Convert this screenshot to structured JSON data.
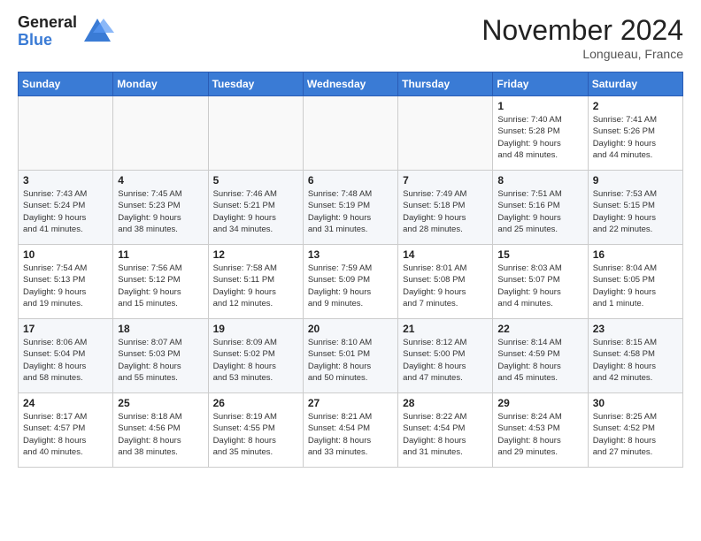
{
  "header": {
    "logo_general": "General",
    "logo_blue": "Blue",
    "month_title": "November 2024",
    "location": "Longueau, France"
  },
  "weekdays": [
    "Sunday",
    "Monday",
    "Tuesday",
    "Wednesday",
    "Thursday",
    "Friday",
    "Saturday"
  ],
  "weeks": [
    [
      {
        "day": "",
        "info": ""
      },
      {
        "day": "",
        "info": ""
      },
      {
        "day": "",
        "info": ""
      },
      {
        "day": "",
        "info": ""
      },
      {
        "day": "",
        "info": ""
      },
      {
        "day": "1",
        "info": "Sunrise: 7:40 AM\nSunset: 5:28 PM\nDaylight: 9 hours\nand 48 minutes."
      },
      {
        "day": "2",
        "info": "Sunrise: 7:41 AM\nSunset: 5:26 PM\nDaylight: 9 hours\nand 44 minutes."
      }
    ],
    [
      {
        "day": "3",
        "info": "Sunrise: 7:43 AM\nSunset: 5:24 PM\nDaylight: 9 hours\nand 41 minutes."
      },
      {
        "day": "4",
        "info": "Sunrise: 7:45 AM\nSunset: 5:23 PM\nDaylight: 9 hours\nand 38 minutes."
      },
      {
        "day": "5",
        "info": "Sunrise: 7:46 AM\nSunset: 5:21 PM\nDaylight: 9 hours\nand 34 minutes."
      },
      {
        "day": "6",
        "info": "Sunrise: 7:48 AM\nSunset: 5:19 PM\nDaylight: 9 hours\nand 31 minutes."
      },
      {
        "day": "7",
        "info": "Sunrise: 7:49 AM\nSunset: 5:18 PM\nDaylight: 9 hours\nand 28 minutes."
      },
      {
        "day": "8",
        "info": "Sunrise: 7:51 AM\nSunset: 5:16 PM\nDaylight: 9 hours\nand 25 minutes."
      },
      {
        "day": "9",
        "info": "Sunrise: 7:53 AM\nSunset: 5:15 PM\nDaylight: 9 hours\nand 22 minutes."
      }
    ],
    [
      {
        "day": "10",
        "info": "Sunrise: 7:54 AM\nSunset: 5:13 PM\nDaylight: 9 hours\nand 19 minutes."
      },
      {
        "day": "11",
        "info": "Sunrise: 7:56 AM\nSunset: 5:12 PM\nDaylight: 9 hours\nand 15 minutes."
      },
      {
        "day": "12",
        "info": "Sunrise: 7:58 AM\nSunset: 5:11 PM\nDaylight: 9 hours\nand 12 minutes."
      },
      {
        "day": "13",
        "info": "Sunrise: 7:59 AM\nSunset: 5:09 PM\nDaylight: 9 hours\nand 9 minutes."
      },
      {
        "day": "14",
        "info": "Sunrise: 8:01 AM\nSunset: 5:08 PM\nDaylight: 9 hours\nand 7 minutes."
      },
      {
        "day": "15",
        "info": "Sunrise: 8:03 AM\nSunset: 5:07 PM\nDaylight: 9 hours\nand 4 minutes."
      },
      {
        "day": "16",
        "info": "Sunrise: 8:04 AM\nSunset: 5:05 PM\nDaylight: 9 hours\nand 1 minute."
      }
    ],
    [
      {
        "day": "17",
        "info": "Sunrise: 8:06 AM\nSunset: 5:04 PM\nDaylight: 8 hours\nand 58 minutes."
      },
      {
        "day": "18",
        "info": "Sunrise: 8:07 AM\nSunset: 5:03 PM\nDaylight: 8 hours\nand 55 minutes."
      },
      {
        "day": "19",
        "info": "Sunrise: 8:09 AM\nSunset: 5:02 PM\nDaylight: 8 hours\nand 53 minutes."
      },
      {
        "day": "20",
        "info": "Sunrise: 8:10 AM\nSunset: 5:01 PM\nDaylight: 8 hours\nand 50 minutes."
      },
      {
        "day": "21",
        "info": "Sunrise: 8:12 AM\nSunset: 5:00 PM\nDaylight: 8 hours\nand 47 minutes."
      },
      {
        "day": "22",
        "info": "Sunrise: 8:14 AM\nSunset: 4:59 PM\nDaylight: 8 hours\nand 45 minutes."
      },
      {
        "day": "23",
        "info": "Sunrise: 8:15 AM\nSunset: 4:58 PM\nDaylight: 8 hours\nand 42 minutes."
      }
    ],
    [
      {
        "day": "24",
        "info": "Sunrise: 8:17 AM\nSunset: 4:57 PM\nDaylight: 8 hours\nand 40 minutes."
      },
      {
        "day": "25",
        "info": "Sunrise: 8:18 AM\nSunset: 4:56 PM\nDaylight: 8 hours\nand 38 minutes."
      },
      {
        "day": "26",
        "info": "Sunrise: 8:19 AM\nSunset: 4:55 PM\nDaylight: 8 hours\nand 35 minutes."
      },
      {
        "day": "27",
        "info": "Sunrise: 8:21 AM\nSunset: 4:54 PM\nDaylight: 8 hours\nand 33 minutes."
      },
      {
        "day": "28",
        "info": "Sunrise: 8:22 AM\nSunset: 4:54 PM\nDaylight: 8 hours\nand 31 minutes."
      },
      {
        "day": "29",
        "info": "Sunrise: 8:24 AM\nSunset: 4:53 PM\nDaylight: 8 hours\nand 29 minutes."
      },
      {
        "day": "30",
        "info": "Sunrise: 8:25 AM\nSunset: 4:52 PM\nDaylight: 8 hours\nand 27 minutes."
      }
    ]
  ]
}
